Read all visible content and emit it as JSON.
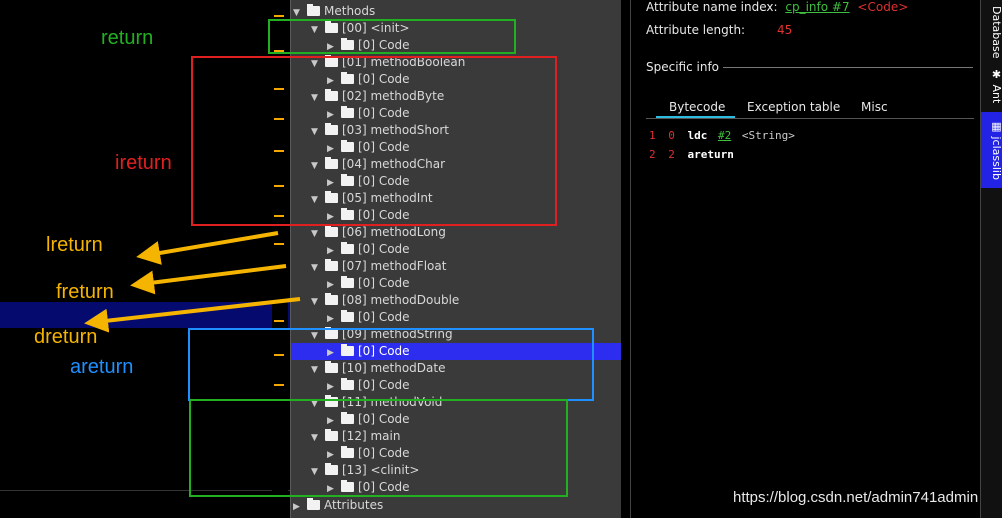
{
  "annotations": {
    "return": "return",
    "ireturn": "ireturn",
    "lreturn": "lreturn",
    "freturn": "freturn",
    "dreturn": "dreturn",
    "areturn": "areturn"
  },
  "tree": {
    "methods_label": "Methods",
    "attributes_label": "Attributes",
    "methods": [
      {
        "label": "[00] <init>",
        "child": "[0] Code"
      },
      {
        "label": "[01] methodBoolean",
        "child": "[0] Code"
      },
      {
        "label": "[02] methodByte",
        "child": "[0] Code"
      },
      {
        "label": "[03] methodShort",
        "child": "[0] Code"
      },
      {
        "label": "[04] methodChar",
        "child": "[0] Code"
      },
      {
        "label": "[05] methodInt",
        "child": "[0] Code"
      },
      {
        "label": "[06] methodLong",
        "child": "[0] Code"
      },
      {
        "label": "[07] methodFloat",
        "child": "[0] Code"
      },
      {
        "label": "[08] methodDouble",
        "child": "[0] Code"
      },
      {
        "label": "[09] methodString",
        "child": "[0] Code"
      },
      {
        "label": "[10] methodDate",
        "child": "[0] Code"
      },
      {
        "label": "[11] methodVoid",
        "child": "[0] Code"
      },
      {
        "label": "[12] main",
        "child": "[0] Code"
      },
      {
        "label": "[13] <clinit>",
        "child": "[0] Code"
      }
    ]
  },
  "details": {
    "attr_name_label": "Attribute name index:",
    "attr_name_link": "cp_info #7",
    "attr_name_value": "<Code>",
    "attr_length_label": "Attribute length:",
    "attr_length_value": "45",
    "specific_info": "Specific info",
    "tabs": [
      "Bytecode",
      "Exception table",
      "Misc"
    ],
    "bytecode": [
      {
        "line": "1",
        "offset": "0",
        "op": "ldc",
        "arg": "#2",
        "comment": "<String>"
      },
      {
        "line": "2",
        "offset": "2",
        "op": "areturn",
        "arg": "",
        "comment": ""
      }
    ]
  },
  "sidebar": {
    "database": "Database",
    "ant": "Ant",
    "jclasslib": "jclasslib"
  },
  "watermark": "https://blog.csdn.net/admin741admin",
  "colors": {
    "green": "#22b022",
    "red": "#e02020",
    "orange": "#f5b400",
    "blue": "#1e90ff",
    "selection": "#2d2df0"
  }
}
